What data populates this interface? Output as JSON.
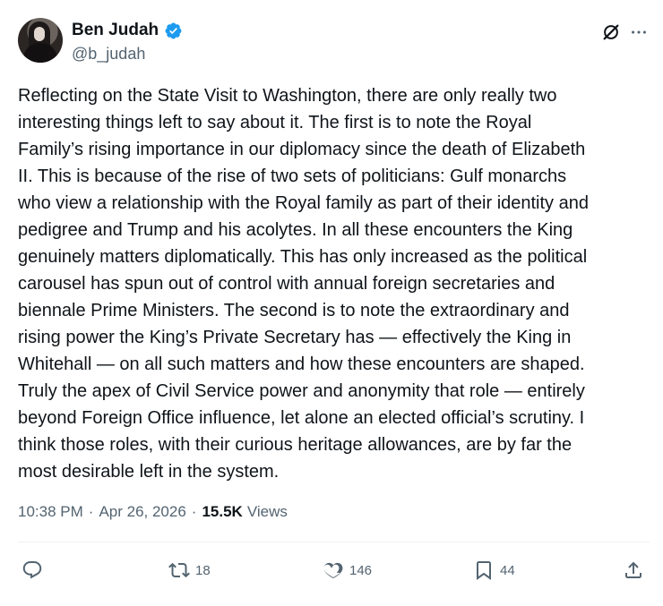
{
  "author": {
    "display_name": "Ben Judah",
    "handle": "@b_judah",
    "verified": true,
    "avatar_icon": "profile-photo"
  },
  "header_icons": {
    "grok": "grok-icon",
    "more": "more-icon"
  },
  "tweet": {
    "lines": [
      "Reflecting on the State Visit to Washington, there are only really two",
      "interesting things left to say about it.  The first is to note the Royal",
      "Family’s rising importance in our diplomacy since the death of Elizabeth",
      "II. This is because of the rise of two sets of politicians: Gulf monarchs",
      "who view a relationship with the Royal family as part of their identity and",
      "pedigree and Trump and his acolytes. In all these encounters the King",
      "genuinely matters diplomatically. This has only increased as the political",
      "carousel has spun out of control with annual foreign secretaries and",
      "biennale Prime Ministers. The second is to note the extraordinary and",
      "rising power the King’s Private Secretary has — effectively the King in",
      "Whitehall — on all such matters and how these encounters are shaped.",
      "Truly the apex of Civil Service power and anonymity that role — entirely",
      "beyond Foreign Office influence, let alone an elected official’s scrutiny. I",
      "think those roles, with their curious heritage allowances, are by far the",
      "most desirable left in the system."
    ]
  },
  "meta": {
    "time": "10:38 PM",
    "separator": "·",
    "date": "Apr 26, 2026",
    "views_count": "15.5K",
    "views_label": "Views"
  },
  "actions": {
    "reply_count": "",
    "retweet_count": "18",
    "like_count": "146",
    "bookmark_count": "44"
  },
  "colors": {
    "text": "#0f1419",
    "secondary": "#536471",
    "verified": "#1d9bf0",
    "divider": "#eff3f4"
  }
}
